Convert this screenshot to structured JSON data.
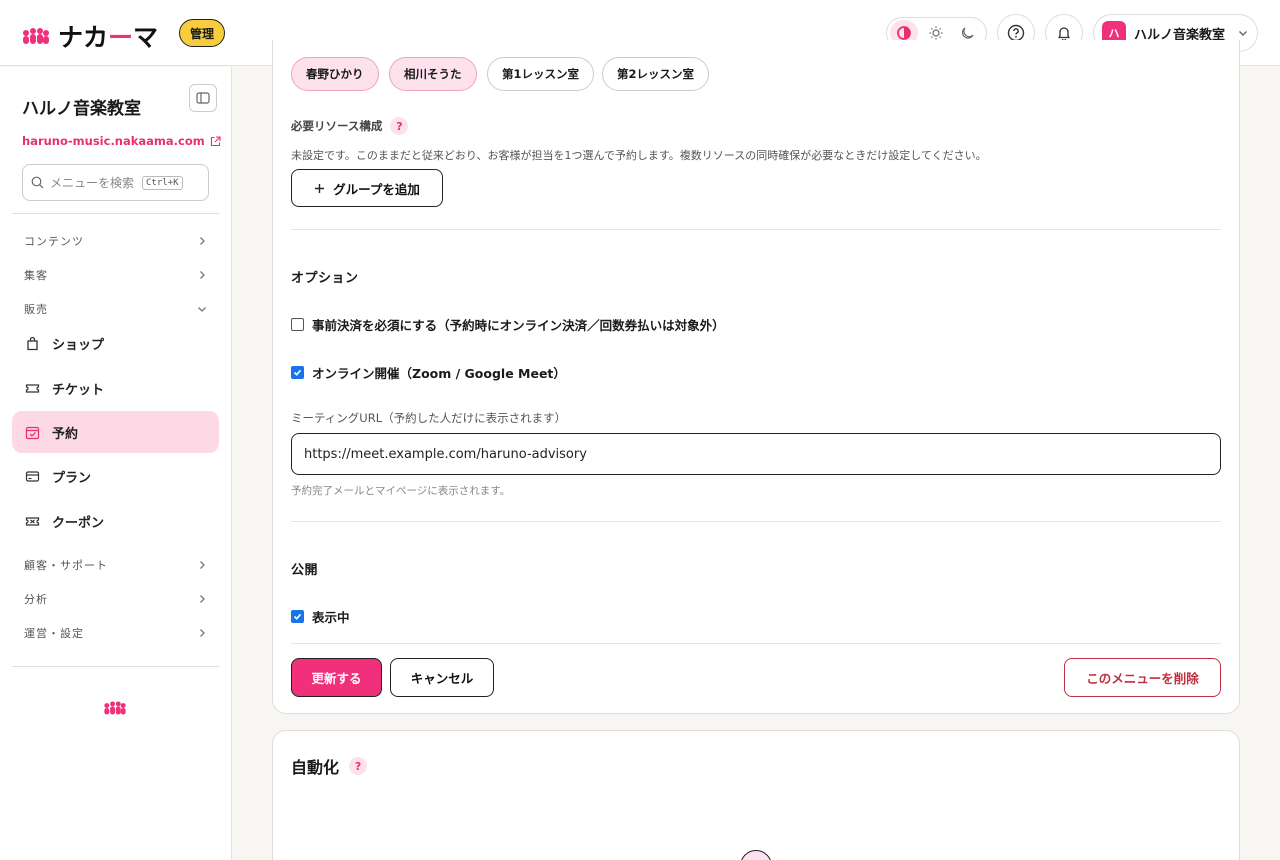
{
  "header": {
    "logo_text_pre": "ナカ",
    "logo_text_accent": "ー",
    "logo_text_post": "マ",
    "admin_badge": "管理",
    "account_avatar": "ハ",
    "account_name": "ハルノ音楽教室"
  },
  "sidebar": {
    "site_name": "ハルノ音楽教室",
    "site_url": "haruno-music.nakaama.com",
    "search_placeholder": "メニューを検索",
    "search_shortcut": "Ctrl+K",
    "groups": {
      "contents": "コンテンツ",
      "marketing": "集客",
      "sales": "販売",
      "customer": "顧客・サポート",
      "analytics": "分析",
      "operations": "運営・設定"
    },
    "items": {
      "shop": "ショップ",
      "ticket": "チケット",
      "booking": "予約",
      "plan": "プラン",
      "coupon": "クーポン"
    }
  },
  "form": {
    "chips": [
      "春野ひかり",
      "相川そうた",
      "第1レッスン室",
      "第2レッスン室"
    ],
    "resource_label": "必要リソース構成",
    "resource_desc": "未設定です。このままだと従来どおり、お客様が担当を1つ選んで予約します。複数リソースの同時確保が必要なときだけ設定してください。",
    "add_group": "グループを追加",
    "options_title": "オプション",
    "prepay_label": "事前決済を必須にする（予約時にオンライン決済／回数券払いは対象外）",
    "prepay_checked": false,
    "online_label": "オンライン開催（Zoom / Google Meet）",
    "online_checked": true,
    "meeting_url_label": "ミーティングURL（予約した人だけに表示されます）",
    "meeting_url_value": "https://meet.example.com/haruno-advisory",
    "meeting_url_hint": "予約完了メールとマイページに表示されます。",
    "publish_title": "公開",
    "visible_label": "表示中",
    "visible_checked": true,
    "update_button": "更新する",
    "cancel_button": "キャンセル",
    "delete_button": "このメニューを削除"
  },
  "automation": {
    "title": "自動化"
  },
  "colors": {
    "accent": "#f0307a",
    "accent_soft": "#fde1ec",
    "badge_yellow": "#f8cd3d",
    "danger": "#c03040"
  }
}
